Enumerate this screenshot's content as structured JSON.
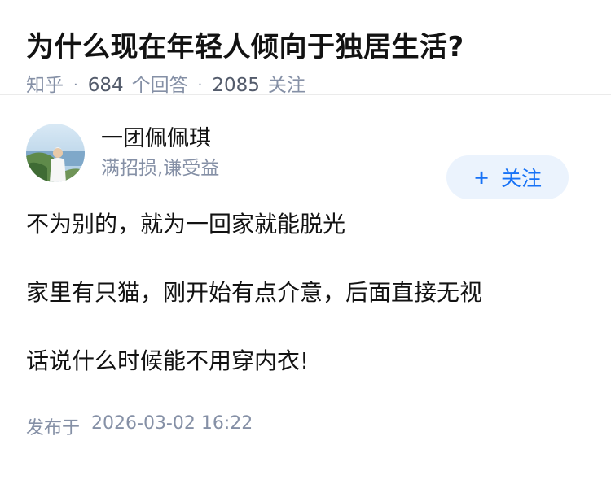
{
  "question": {
    "title": "为什么现在年轻人倾向于独居生活?",
    "source": "知乎",
    "separator": "·",
    "answer_count": "684",
    "answer_label": "个回答",
    "follow_count": "2085",
    "follow_label": "关注"
  },
  "author": {
    "name": "一团佩佩琪",
    "headline": "满招损,谦受益",
    "follow_button_plus": "+",
    "follow_button_label": "关注"
  },
  "content": {
    "paragraphs": [
      "不为别的，就为一回家就能脱光",
      "家里有只猫，刚开始有点介意，后面直接无视",
      "话说什么时候能不用穿内衣!"
    ]
  },
  "publish": {
    "label": "发布于",
    "datetime": "2026-03-02 16:22"
  }
}
